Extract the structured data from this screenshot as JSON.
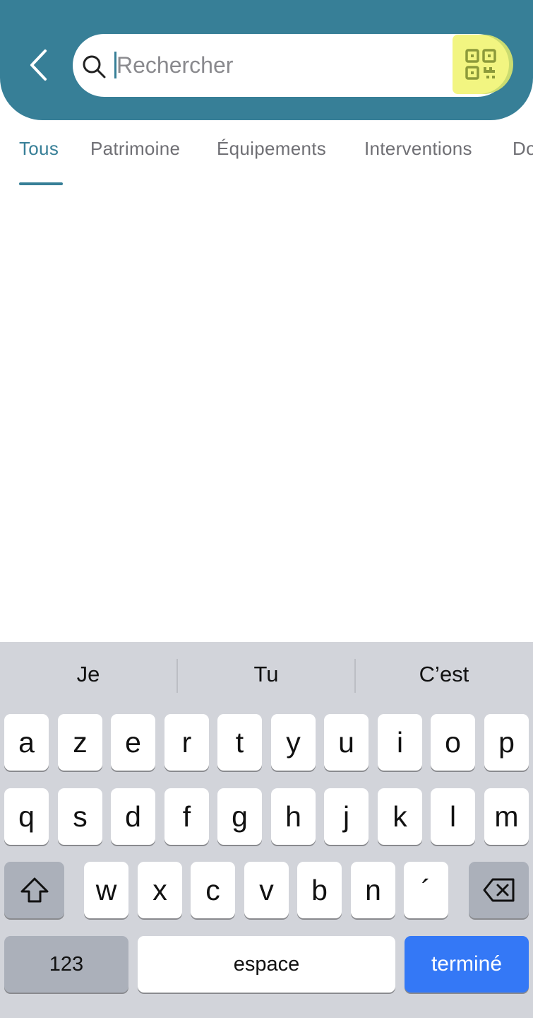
{
  "search": {
    "placeholder": "Rechercher",
    "value": ""
  },
  "tabs": [
    {
      "label": "Tous",
      "active": true
    },
    {
      "label": "Patrimoine",
      "active": false
    },
    {
      "label": "Équipements",
      "active": false
    },
    {
      "label": "Interventions",
      "active": false
    },
    {
      "label": "Do",
      "active": false
    }
  ],
  "keyboard": {
    "suggestions": [
      "Je",
      "Tu",
      "C’est"
    ],
    "row1": [
      "a",
      "z",
      "e",
      "r",
      "t",
      "y",
      "u",
      "i",
      "o",
      "p"
    ],
    "row2": [
      "q",
      "s",
      "d",
      "f",
      "g",
      "h",
      "j",
      "k",
      "l",
      "m"
    ],
    "row3": [
      "w",
      "x",
      "c",
      "v",
      "b",
      "n",
      "´"
    ],
    "numbers_label": "123",
    "space_label": "espace",
    "done_label": "terminé"
  },
  "colors": {
    "header": "#377f97",
    "accent": "#377f97",
    "qr_highlight": "#f2f581",
    "done_key": "#3478f6"
  },
  "icons": {
    "back": "chevron-left-icon",
    "search": "search-icon",
    "qr": "qr-code-icon",
    "shift": "shift-icon",
    "backspace": "backspace-icon"
  }
}
